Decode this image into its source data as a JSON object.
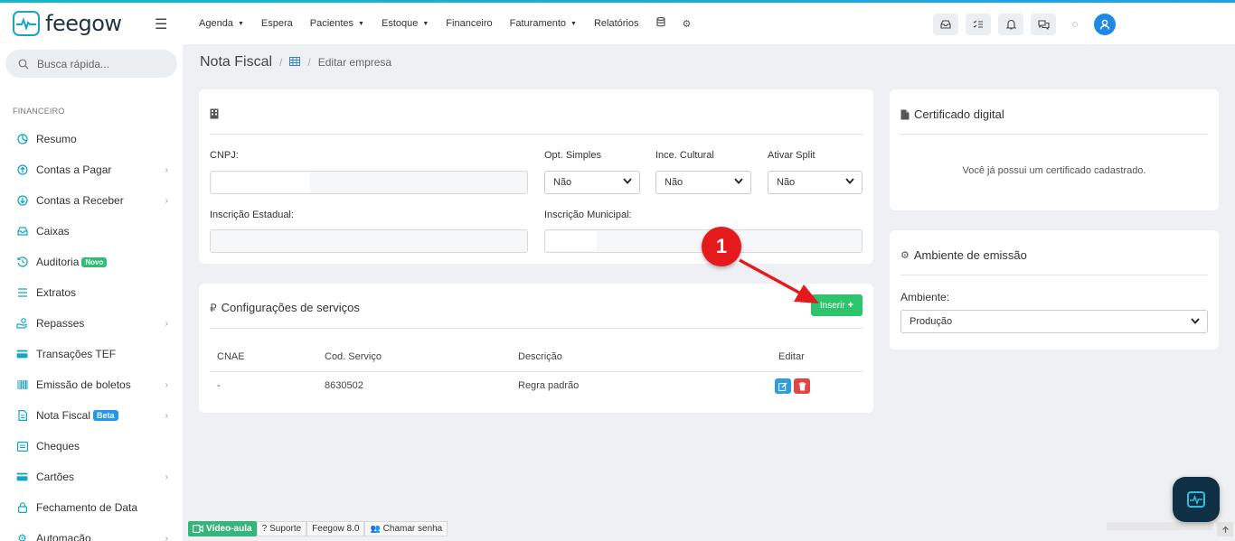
{
  "header": {
    "logo_text": "feegow",
    "nav": [
      {
        "label": "Agenda",
        "dropdown": true
      },
      {
        "label": "Espera",
        "dropdown": false
      },
      {
        "label": "Pacientes",
        "dropdown": true
      },
      {
        "label": "Estoque",
        "dropdown": true
      },
      {
        "label": "Financeiro",
        "dropdown": false
      },
      {
        "label": "Faturamento",
        "dropdown": true
      },
      {
        "label": "Relatórios",
        "dropdown": false
      }
    ],
    "nav_icons": [
      "database-icon",
      "gear-icon"
    ],
    "top_icons": [
      "inbox-icon",
      "tasks-icon",
      "bell-icon",
      "chat-icon"
    ]
  },
  "sidebar": {
    "search_placeholder": "Busca rápida...",
    "section": "FINANCEIRO",
    "items": [
      {
        "label": "Resumo",
        "icon": "pie-chart-icon",
        "chevron": false
      },
      {
        "label": "Contas a Pagar",
        "icon": "arrow-up-circle-icon",
        "chevron": true
      },
      {
        "label": "Contas a Receber",
        "icon": "arrow-down-circle-icon",
        "chevron": true
      },
      {
        "label": "Caixas",
        "icon": "tray-icon",
        "chevron": false
      },
      {
        "label": "Auditoria",
        "icon": "history-icon",
        "chevron": false,
        "badge": "Novo"
      },
      {
        "label": "Extratos",
        "icon": "list-icon",
        "chevron": false
      },
      {
        "label": "Repasses",
        "icon": "hand-coins-icon",
        "chevron": true
      },
      {
        "label": "Transações TEF",
        "icon": "card-icon",
        "chevron": false
      },
      {
        "label": "Emissão de boletos",
        "icon": "barcode-icon",
        "chevron": true
      },
      {
        "label": "Nota Fiscal",
        "icon": "document-icon",
        "chevron": true,
        "badge": "Beta"
      },
      {
        "label": "Cheques",
        "icon": "check-doc-icon",
        "chevron": false
      },
      {
        "label": "Cartões",
        "icon": "credit-card-icon",
        "chevron": true
      },
      {
        "label": "Fechamento de Data",
        "icon": "lock-icon",
        "chevron": false
      },
      {
        "label": "Automação",
        "icon": "cogs-icon",
        "chevron": true
      }
    ]
  },
  "breadcrumb": {
    "title": "Nota Fiscal",
    "sep": "/",
    "item": "Editar empresa"
  },
  "company_form": {
    "cnpj_label": "CNPJ:",
    "cnpj_value": "",
    "opt_simples_label": "Opt. Simples",
    "opt_simples_value": "Não",
    "ince_cultural_label": "Ince. Cultural",
    "ince_cultural_value": "Não",
    "ativar_split_label": "Ativar Split",
    "ativar_split_value": "Não",
    "insc_estadual_label": "Inscrição Estadual:",
    "insc_estadual_value": "",
    "insc_municipal_label": "Inscrição Municipal:",
    "insc_municipal_value": ""
  },
  "services": {
    "title": "Configurações de serviços",
    "insert_label": "Inserir",
    "columns": [
      "CNAE",
      "Cod. Serviço",
      "Descrição",
      "Editar"
    ],
    "rows": [
      {
        "cnae": "-",
        "cod_servico": "8630502",
        "descricao": "Regra padrão"
      }
    ]
  },
  "certificate": {
    "title": "Certificado digital",
    "message": "Você já possui um certificado cadastrado."
  },
  "environment": {
    "title": "Ambiente de emissão",
    "label": "Ambiente:",
    "value": "Produção"
  },
  "annotation": {
    "number": "1"
  },
  "footer": {
    "video": "Vídeo-aula",
    "support": "Suporte",
    "version": "Feegow 8.0",
    "call": "Chamar senha"
  },
  "colors": {
    "accent": "#13a6c6",
    "insert_button": "#2dc46b",
    "annotation": "#e41a1c",
    "edit_button": "#2d9be6",
    "delete_button": "#e04646"
  }
}
